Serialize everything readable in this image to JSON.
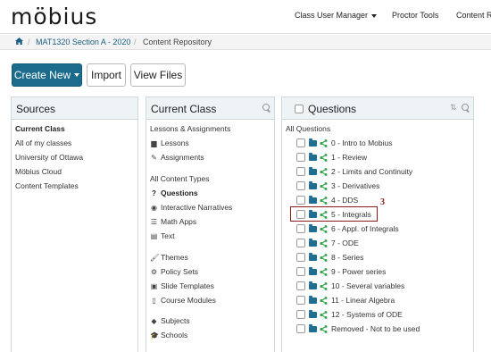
{
  "app": {
    "logo": "möbius",
    "nav": [
      {
        "label": "Class User Manager",
        "dropdown": true
      },
      {
        "label": "Proctor Tools",
        "dropdown": false
      },
      {
        "label": "Content R",
        "dropdown": false
      }
    ]
  },
  "breadcrumb": {
    "home_icon": "home-icon",
    "course": "MAT1320 Section A - 2020",
    "current": "Content Repository"
  },
  "toolbar": {
    "create_new": "Create New",
    "import": "Import",
    "view_files": "View Files"
  },
  "sources": {
    "title": "Sources",
    "items": [
      {
        "label": "Current Class",
        "bold": true
      },
      {
        "label": "All of my classes",
        "bold": false
      },
      {
        "label": "University of Ottawa",
        "bold": false
      },
      {
        "label": "Möbius Cloud",
        "bold": false
      },
      {
        "label": "Content Templates",
        "bold": false
      }
    ]
  },
  "current_class": {
    "title": "Current Class",
    "section1_title": "Lessons & Assignments",
    "lessons": "Lessons",
    "assignments": "Assignments",
    "section2_title": "All Content Types",
    "questions": "Questions",
    "interactive_narratives": "Interactive Narratives",
    "math_apps": "Math Apps",
    "text": "Text",
    "themes": "Themes",
    "policy_sets": "Policy Sets",
    "slide_templates": "Slide Templates",
    "course_modules": "Course Modules",
    "subjects": "Subjects",
    "schools": "Schools"
  },
  "questions": {
    "title": "Questions",
    "all_label": "All Questions",
    "folders": [
      "0 - Intro to Mobius",
      "1 - Review",
      "2 - Limits and Continuity",
      "3 - Derivatives",
      "4 - DDS",
      "5 - Integrals",
      "6 - Appl. of Integrals",
      "7 - ODE",
      "8 - Series",
      "9 - Power series",
      "10 - Several variables",
      "11 - Linear Algebra",
      "12 - Systems of ODE",
      "Removed - Not to be used"
    ],
    "highlighted_index": 5,
    "annotation": "3"
  },
  "colors": {
    "primary": "#1b6b8d",
    "folder": "#1f6f95",
    "share": "#3aa655",
    "highlight": "#8b1a1a"
  }
}
